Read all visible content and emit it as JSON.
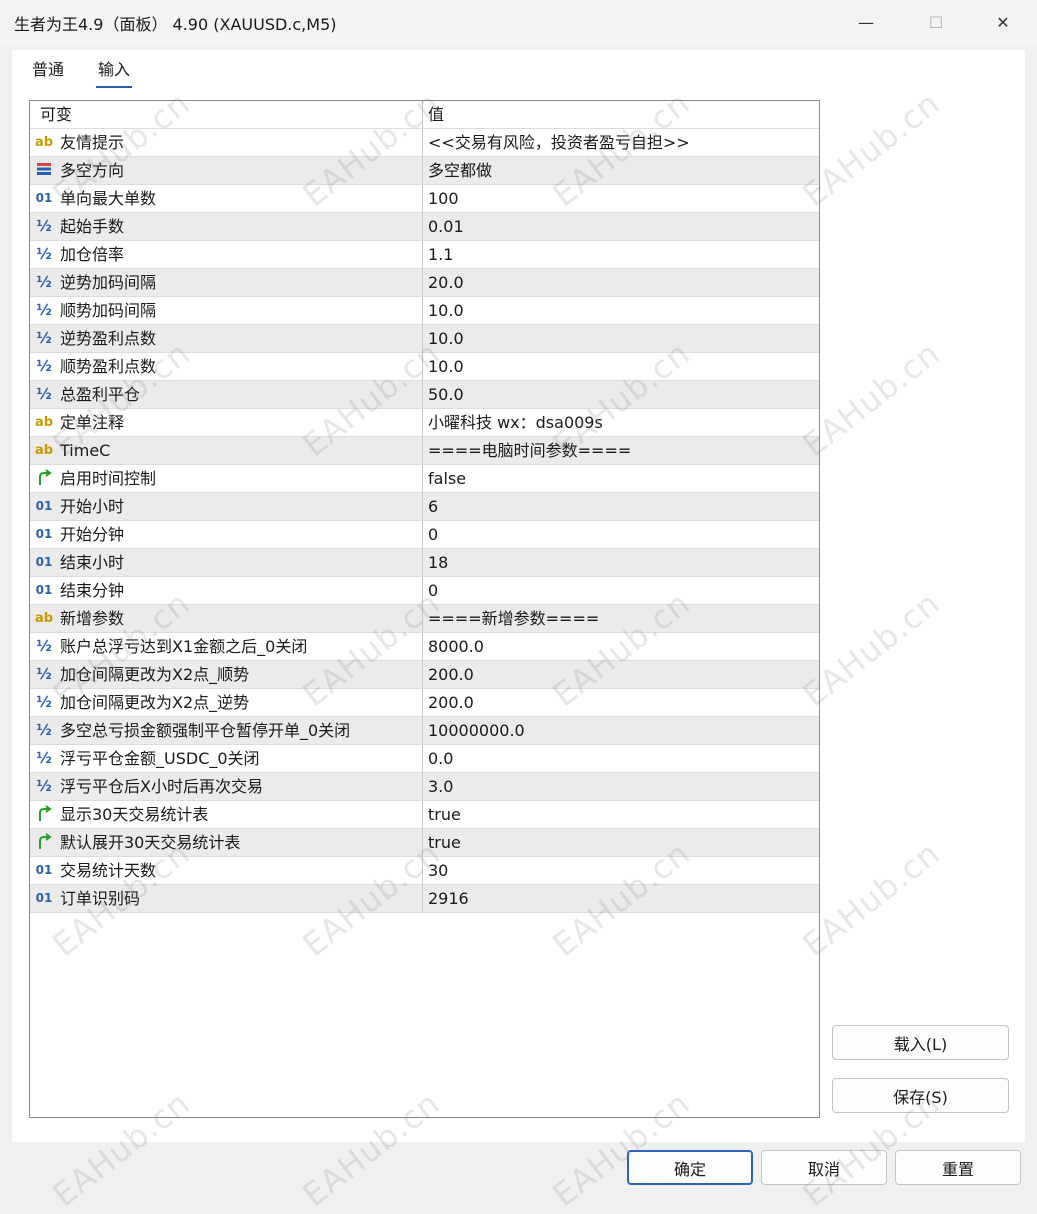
{
  "window": {
    "title": "生者为王4.9（面板） 4.90 (XAUUSD.c,M5)",
    "min_glyph": "—",
    "max_glyph": "☐",
    "close_glyph": "✕"
  },
  "tabs": [
    {
      "label": "普通"
    },
    {
      "label": "输入"
    }
  ],
  "grid": {
    "header": {
      "variable": "可变",
      "value": "值"
    },
    "rows": [
      {
        "icon": "ab",
        "name": "友情提示",
        "value": "<<交易有风险，投资者盈亏自担>>"
      },
      {
        "icon": "enum",
        "name": "多空方向",
        "value": "多空都做"
      },
      {
        "icon": "01",
        "name": "单向最大单数",
        "value": "100"
      },
      {
        "icon": "half",
        "name": "起始手数",
        "value": "0.01"
      },
      {
        "icon": "half",
        "name": "加仓倍率",
        "value": "1.1"
      },
      {
        "icon": "half",
        "name": "逆势加码间隔",
        "value": "20.0"
      },
      {
        "icon": "half",
        "name": "顺势加码间隔",
        "value": "10.0"
      },
      {
        "icon": "half",
        "name": "逆势盈利点数",
        "value": "10.0"
      },
      {
        "icon": "half",
        "name": "顺势盈利点数",
        "value": "10.0"
      },
      {
        "icon": "half",
        "name": "总盈利平仓",
        "value": "50.0"
      },
      {
        "icon": "ab",
        "name": "定单注释",
        "value": "小曜科技 wx：dsa009s"
      },
      {
        "icon": "ab",
        "name": "TimeC",
        "value": "====电脑时间参数===="
      },
      {
        "icon": "bool",
        "name": "启用时间控制",
        "value": "false"
      },
      {
        "icon": "01",
        "name": "开始小时",
        "value": "6"
      },
      {
        "icon": "01",
        "name": "开始分钟",
        "value": "0"
      },
      {
        "icon": "01",
        "name": "结束小时",
        "value": "18"
      },
      {
        "icon": "01",
        "name": "结束分钟",
        "value": "0"
      },
      {
        "icon": "ab",
        "name": "新增参数",
        "value": "====新增参数===="
      },
      {
        "icon": "half",
        "name": "账户总浮亏达到X1金额之后_0关闭",
        "value": "8000.0"
      },
      {
        "icon": "half",
        "name": "加仓间隔更改为X2点_顺势",
        "value": "200.0"
      },
      {
        "icon": "half",
        "name": "加仓间隔更改为X2点_逆势",
        "value": "200.0"
      },
      {
        "icon": "half",
        "name": "多空总亏损金额强制平仓暂停开单_0关闭",
        "value": "10000000.0"
      },
      {
        "icon": "half",
        "name": "浮亏平仓金额_USDC_0关闭",
        "value": "0.0"
      },
      {
        "icon": "half",
        "name": "浮亏平仓后X小时后再次交易",
        "value": "3.0"
      },
      {
        "icon": "bool",
        "name": "显示30天交易统计表",
        "value": "true"
      },
      {
        "icon": "bool",
        "name": "默认展开30天交易统计表",
        "value": "true"
      },
      {
        "icon": "01",
        "name": "交易统计天数",
        "value": "30"
      },
      {
        "icon": "01",
        "name": "订单识别码",
        "value": "2916"
      }
    ]
  },
  "icon_glyphs": {
    "ab": "ab",
    "01": "01",
    "half": "½"
  },
  "buttons": {
    "load": "载入(L)",
    "save": "保存(S)",
    "ok": "确定",
    "cancel": "取消",
    "reset": "重置"
  },
  "watermark": "EAHub.cn",
  "colors": {
    "accent": "#2b63b8",
    "string_icon": "#c89a00",
    "number_icon": "#2b5fb0",
    "bool_icon": "#22a02a",
    "enum_icon": "#d9463a"
  }
}
